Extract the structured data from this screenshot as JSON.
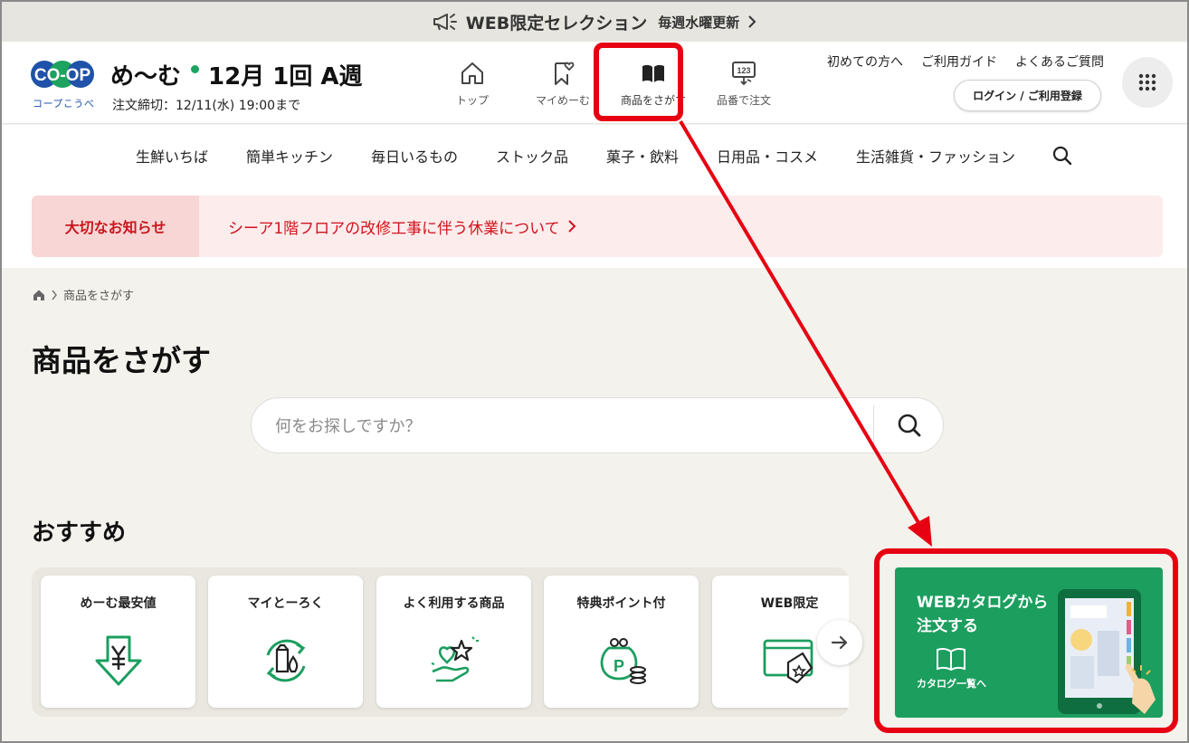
{
  "banner": {
    "title": "WEB限定セレクション",
    "subtitle": "毎週水曜更新",
    "icon": "megaphone-icon"
  },
  "header": {
    "logo_text": "CO-OP",
    "logo_sub": "コープこうべ",
    "brand": "め〜む",
    "week_label": "12月 1回 A週",
    "deadline": "注文締切：12/11(水) 19:00まで",
    "nav": [
      {
        "label": "トップ",
        "icon": "home-icon"
      },
      {
        "label": "マイめーむ",
        "icon": "bookmark-heart-icon"
      },
      {
        "label": "商品をさがす",
        "icon": "open-book-icon"
      },
      {
        "label": "品番で注文",
        "icon": "number-entry-icon"
      }
    ],
    "links": [
      "初めての方へ",
      "ご利用ガイド",
      "よくあるご質問"
    ],
    "login_label": "ログイン / ご利用登録"
  },
  "categories": [
    "生鮮いちば",
    "簡単キッチン",
    "毎日いるもの",
    "ストック品",
    "菓子・飲料",
    "日用品・コスメ",
    "生活雑貨・ファッション"
  ],
  "notice": {
    "tag": "大切なお知らせ",
    "message": "シーア1階フロアの改修工事に伴う休業について"
  },
  "breadcrumb": {
    "current": "商品をさがす"
  },
  "page_title": "商品をさがす",
  "search": {
    "placeholder": "何をお探しですか？"
  },
  "recommend": {
    "title": "おすすめ",
    "cards": [
      {
        "label": "めーむ最安値",
        "icon": "yen-down-icon"
      },
      {
        "label": "マイとーろく",
        "icon": "recycle-grocery-icon"
      },
      {
        "label": "よく利用する商品",
        "icon": "hand-heart-star-icon"
      },
      {
        "label": "特典ポイント付",
        "icon": "point-purse-icon"
      },
      {
        "label": "WEB限定",
        "icon": "web-tag-icon"
      }
    ]
  },
  "catalog": {
    "title": "WEBカタログから注文する",
    "link": "カタログ一覧へ"
  },
  "colors": {
    "accent_green": "#1c9e5f",
    "notice_red": "#d0121c",
    "annotation_red": "#e60012",
    "coop_blue": "#1f52a8"
  }
}
